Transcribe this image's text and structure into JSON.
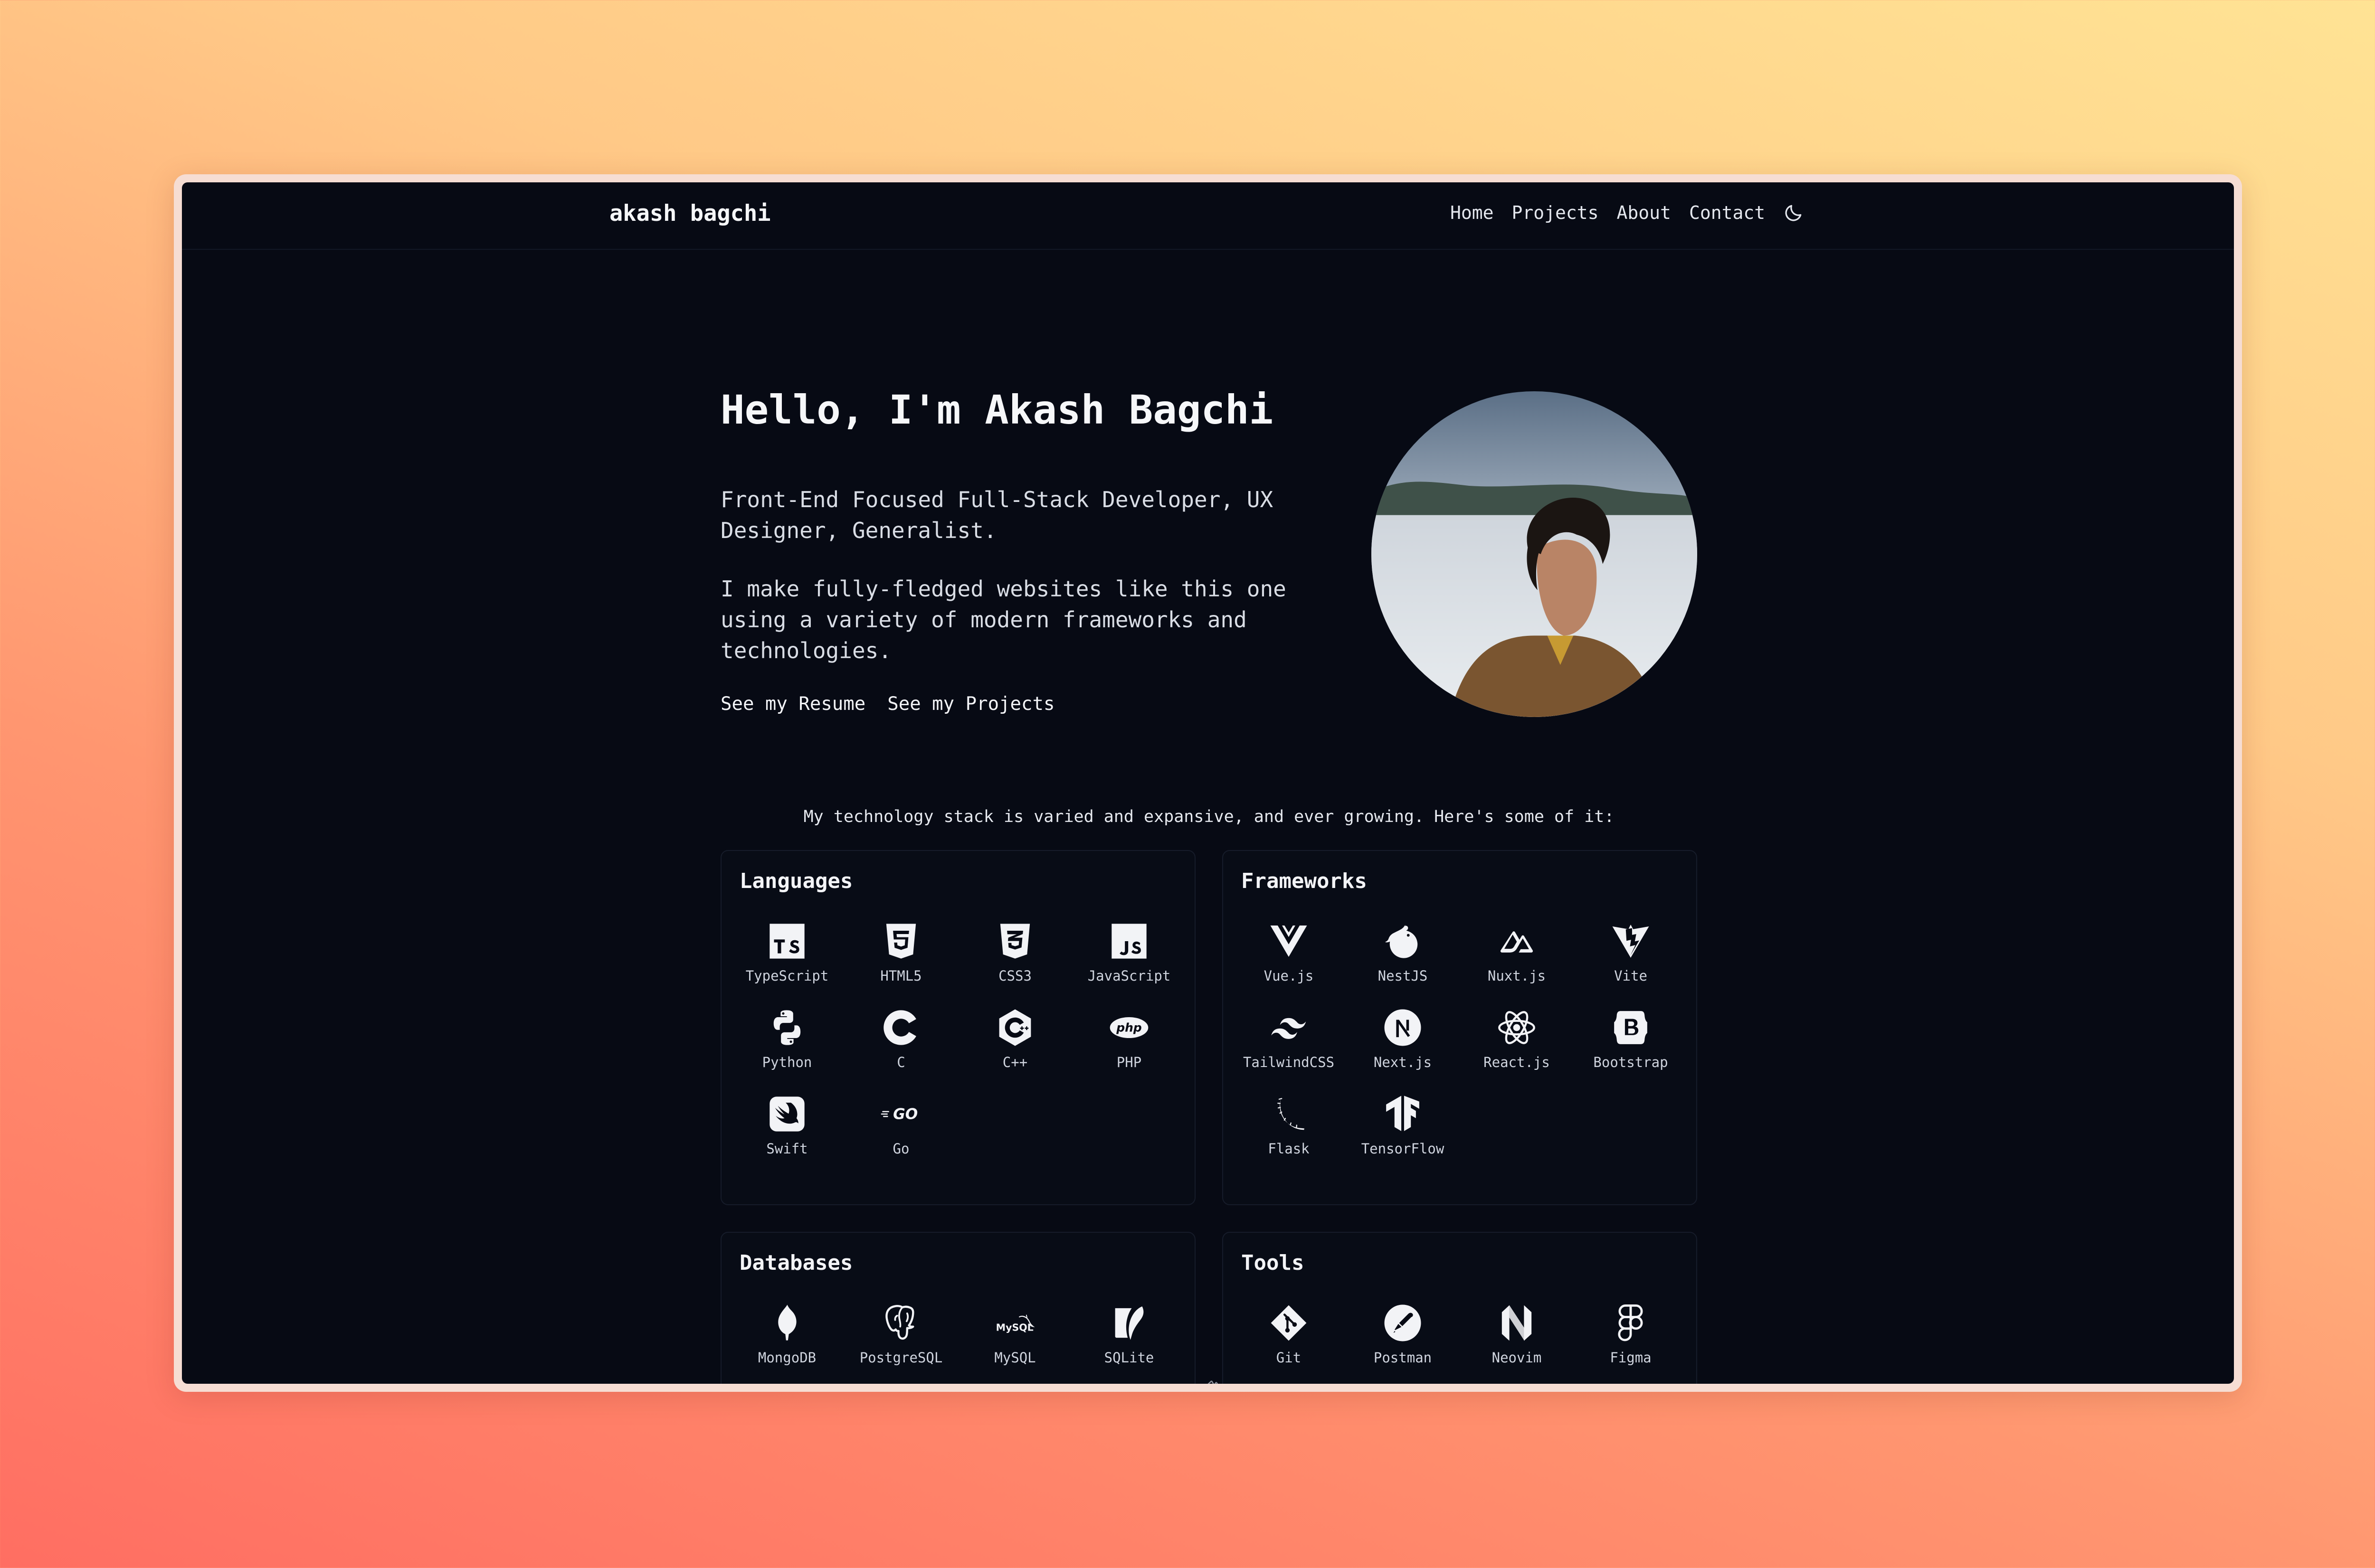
{
  "header": {
    "brand": "akash bagchi",
    "nav": [
      "Home",
      "Projects",
      "About",
      "Contact"
    ]
  },
  "hero": {
    "title": "Hello, I'm Akash Bagchi",
    "subtitle": "Front-End Focused Full-Stack Developer, UX Designer, Generalist.",
    "description": "I make fully-fledged websites like this one using a variety of modern frameworks and technologies.",
    "buttons": {
      "resume": "See my Resume",
      "projects": "See my Projects"
    }
  },
  "stack": {
    "intro": "My technology stack is varied and expansive, and ever growing. Here's some of it:",
    "categories": [
      {
        "title": "Languages",
        "items": [
          {
            "label": "TypeScript",
            "icon": "typescript-icon"
          },
          {
            "label": "HTML5",
            "icon": "html5-icon"
          },
          {
            "label": "CSS3",
            "icon": "css3-icon"
          },
          {
            "label": "JavaScript",
            "icon": "javascript-icon"
          },
          {
            "label": "Python",
            "icon": "python-icon"
          },
          {
            "label": "C",
            "icon": "c-icon"
          },
          {
            "label": "C++",
            "icon": "cplusplus-icon"
          },
          {
            "label": "PHP",
            "icon": "php-icon"
          },
          {
            "label": "Swift",
            "icon": "swift-icon"
          },
          {
            "label": "Go",
            "icon": "go-icon"
          }
        ]
      },
      {
        "title": "Frameworks",
        "items": [
          {
            "label": "Vue.js",
            "icon": "vue-icon"
          },
          {
            "label": "NestJS",
            "icon": "nestjs-icon"
          },
          {
            "label": "Nuxt.js",
            "icon": "nuxt-icon"
          },
          {
            "label": "Vite",
            "icon": "vite-icon"
          },
          {
            "label": "TailwindCSS",
            "icon": "tailwind-icon"
          },
          {
            "label": "Next.js",
            "icon": "nextjs-icon"
          },
          {
            "label": "React.js",
            "icon": "react-icon"
          },
          {
            "label": "Bootstrap",
            "icon": "bootstrap-icon"
          },
          {
            "label": "Flask",
            "icon": "flask-icon"
          },
          {
            "label": "TensorFlow",
            "icon": "tensorflow-icon"
          }
        ]
      },
      {
        "title": "Databases",
        "items": [
          {
            "label": "MongoDB",
            "icon": "mongodb-icon"
          },
          {
            "label": "PostgreSQL",
            "icon": "postgresql-icon"
          },
          {
            "label": "MySQL",
            "icon": "mysql-icon"
          },
          {
            "label": "SQLite",
            "icon": "sqlite-icon"
          }
        ]
      },
      {
        "title": "Tools",
        "items": [
          {
            "label": "Git",
            "icon": "git-icon"
          },
          {
            "label": "Postman",
            "icon": "postman-icon"
          },
          {
            "label": "Neovim",
            "icon": "neovim-icon"
          },
          {
            "label": "Figma",
            "icon": "figma-icon"
          }
        ]
      }
    ]
  },
  "icon_glyphs": {
    "mysql": "MySQL"
  },
  "colors": {
    "background": "#070a14",
    "text": "#f1f3f7",
    "card_border": "#161c2a"
  }
}
